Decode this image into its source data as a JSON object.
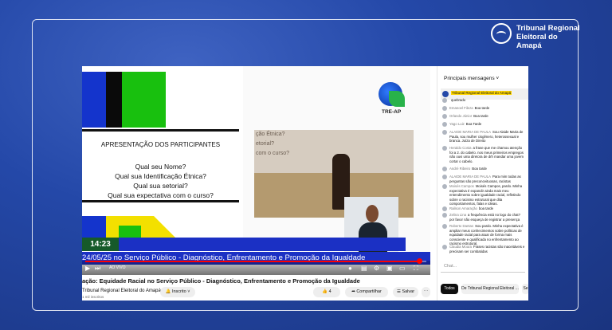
{
  "brand": {
    "name_line1": "Tribunal Regional",
    "name_line2": "Eleitoral do Amapá"
  },
  "slide": {
    "title": "APRESENTAÇÃO DOS PARTICIPANTES",
    "questions": [
      "Qual seu Nome?",
      "Qual sua Identificação Étnica?",
      "Qual sua setorial?",
      "Qual sua expectativa com o curso?"
    ],
    "logo_label": "TRE-AP",
    "screen_lines": [
      "ção Étnica?",
      "etorial?",
      "com o curso?"
    ]
  },
  "ticker": {
    "time": "14:23",
    "date_text": "24/05/25 no Serviço Público - Diagnóstico, Enfrentamento e Promoção da Igualdade"
  },
  "player": {
    "live_label": "AO VIVO",
    "progress": 0.98
  },
  "video": {
    "title": "ação: Equidade Racial no Serviço Público - Diagnóstico, Enfrentamento e Promoção da Igualdade",
    "channel": "Tribunal Regional Eleitoral do Amapá",
    "subscribers": "1 mil inscritos",
    "subscribed_label": "Inscrito",
    "likes": "4",
    "share_label": "Compartilhar",
    "save_label": "Salvar"
  },
  "chat": {
    "header": "Principais mensagens",
    "pinned": "Tribunal Regional Eleitoral do Amapá",
    "messages": [
      {
        "author": "",
        "text": "quebrado"
      },
      {
        "author": "Emanoel Fileza",
        "text": "Boa tarde"
      },
      {
        "author": "Orlando Júnior",
        "text": "Boa tarde"
      },
      {
        "author": "Yago Luiz",
        "text": "Boa Tarde"
      },
      {
        "author": "ALAIDE MARIA DE PAULA",
        "text": "Sou Alaide Maria de Paula, sou mulher cisgênero, heterossexual e branca. Juíza de Direito"
      },
      {
        "author": "Heraldo Costa",
        "text": "a frase que me chamou atenção foi a 2. do cabelo. nos meus primeiros empregos não ouvi uma diretora de drh mandar uma jovem cortar o cabelo."
      },
      {
        "author": "André Ribeiro",
        "text": "Boa tarde"
      },
      {
        "author": "ALAIDE MARIA DE PAULA",
        "text": "Para mim todas as perguntas são preconceituosas, racistas"
      },
      {
        "author": "Moisés Campos",
        "text": "Moisés Campos, pardo. Minha expectativa é expandir ainda mais meu entendimento sobre igualdade racial, refletindo sobre o racismo estrutural que dita comportamentos, falas e ideias."
      },
      {
        "author": "Railson Amaração",
        "text": "boa tarde"
      },
      {
        "author": "Zelina Lina",
        "text": "a frequência está no logo do chat? por favor não esqueça de registrar a presença"
      },
      {
        "author": "Roberto Dantas",
        "text": "Sou pardo. Minha expectativa é ampliar meus conhecimentos sobre políticas de equidade racial para atuar de forma mais consciente e qualificada no enfrentamento ao racismo estrutural."
      },
      {
        "author": "Claudia Moura",
        "text": "Frases racistas são inaceitáveis e precisam ser combatidas"
      }
    ],
    "input_placeholder": "Chat...",
    "chips": [
      "Todos",
      "De Tribunal Regional Eleitoral ...",
      "Se"
    ]
  }
}
